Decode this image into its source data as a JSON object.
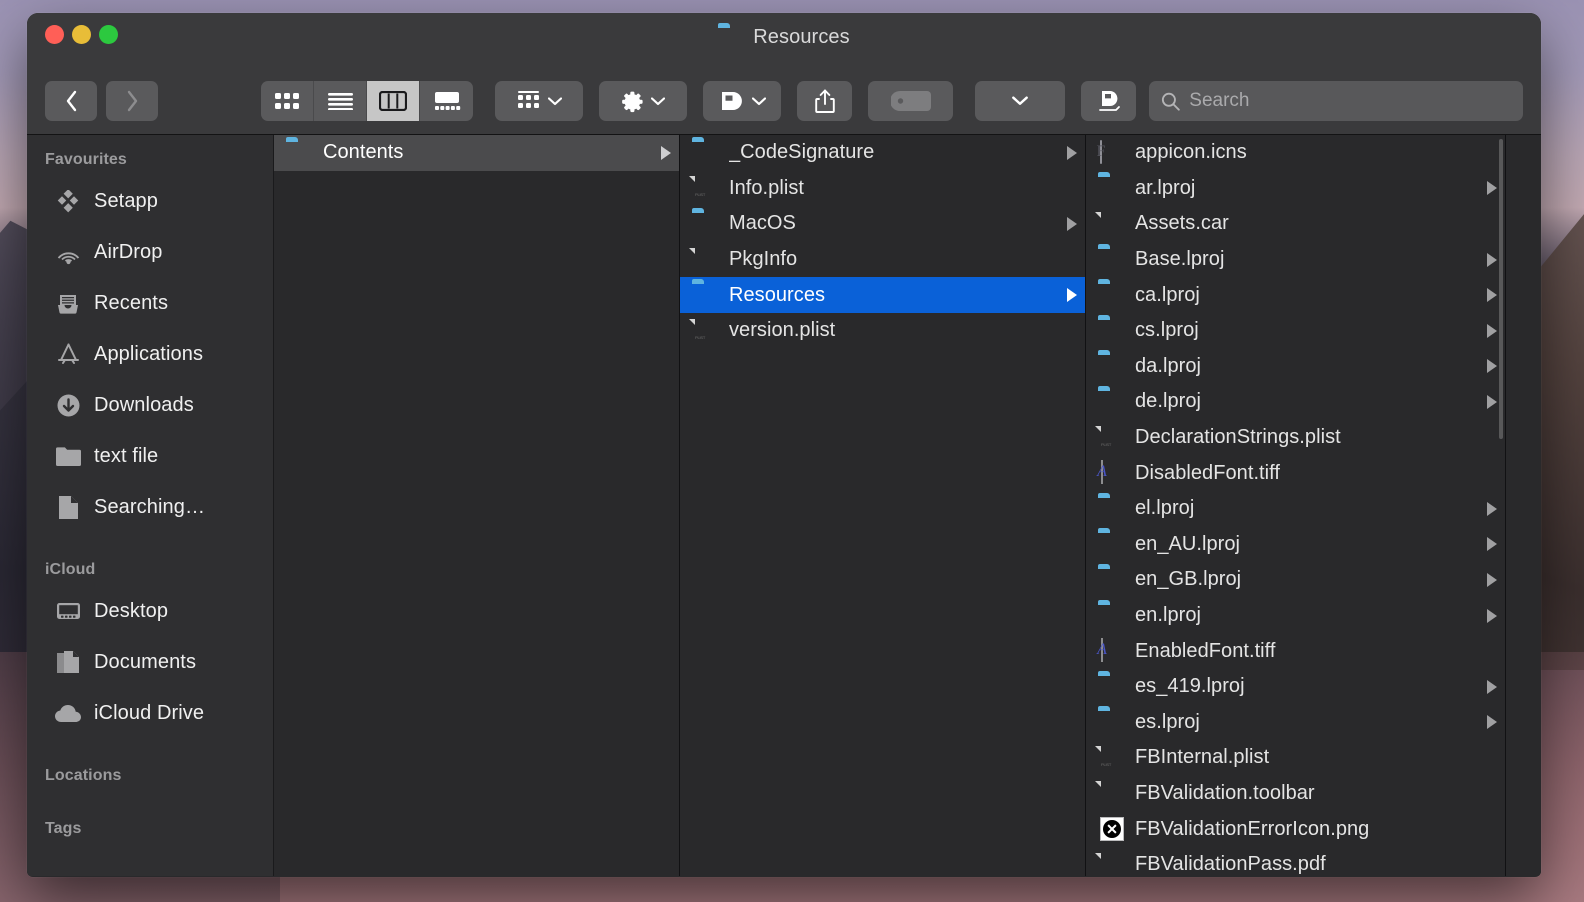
{
  "window": {
    "title": "Resources",
    "title_icon": "folder-icon",
    "traffic_lights": [
      "close",
      "minimize",
      "zoom"
    ]
  },
  "toolbar": {
    "back_label": "‹",
    "forward_label": "›",
    "view_modes": [
      {
        "name": "icon-view",
        "active": false
      },
      {
        "name": "list-view",
        "active": false
      },
      {
        "name": "column-view",
        "active": true
      },
      {
        "name": "gallery-view",
        "active": false
      }
    ],
    "group_button": "group-icon",
    "action_button": "gear-icon",
    "quicklook_button": "dropbox-icon",
    "share_button": "share-icon",
    "tag_button": "tag-icon",
    "extra_button": "chevron-down-icon",
    "dropbox_button": "dropbox-badge-icon",
    "search": {
      "placeholder": "Search",
      "value": "",
      "icon": "search-icon"
    }
  },
  "sidebar": {
    "sections": [
      {
        "header": "Favourites",
        "items": [
          {
            "label": "Setapp",
            "icon": "setapp-icon"
          },
          {
            "label": "AirDrop",
            "icon": "airdrop-icon"
          },
          {
            "label": "Recents",
            "icon": "recents-icon"
          },
          {
            "label": "Applications",
            "icon": "applications-icon"
          },
          {
            "label": "Downloads",
            "icon": "downloads-icon"
          },
          {
            "label": "text file",
            "icon": "folder-icon"
          },
          {
            "label": "Searching…",
            "icon": "document-icon"
          }
        ]
      },
      {
        "header": "iCloud",
        "items": [
          {
            "label": "Desktop",
            "icon": "desktop-icon"
          },
          {
            "label": "Documents",
            "icon": "documents-icon"
          },
          {
            "label": "iCloud Drive",
            "icon": "cloud-icon"
          }
        ]
      },
      {
        "header": "Locations",
        "items": []
      },
      {
        "header": "Tags",
        "items": []
      }
    ]
  },
  "columns": [
    {
      "name": "column-1",
      "items": [
        {
          "label": "Contents",
          "icon": "folder-icon",
          "kind": "folder",
          "has_arrow": true,
          "selected": "inactive"
        }
      ]
    },
    {
      "name": "column-2",
      "items": [
        {
          "label": "_CodeSignature",
          "icon": "folder-icon",
          "kind": "folder",
          "has_arrow": true,
          "selected": "none"
        },
        {
          "label": "Info.plist",
          "icon": "plist-icon",
          "kind": "plist",
          "has_arrow": false,
          "selected": "none"
        },
        {
          "label": "MacOS",
          "icon": "folder-icon",
          "kind": "folder",
          "has_arrow": true,
          "selected": "none"
        },
        {
          "label": "PkgInfo",
          "icon": "document-icon",
          "kind": "doc",
          "has_arrow": false,
          "selected": "none"
        },
        {
          "label": "Resources",
          "icon": "folder-icon",
          "kind": "folder",
          "has_arrow": true,
          "selected": "active"
        },
        {
          "label": "version.plist",
          "icon": "plist-icon",
          "kind": "plist",
          "has_arrow": false,
          "selected": "none"
        }
      ]
    },
    {
      "name": "column-3",
      "items": [
        {
          "label": "appicon.icns",
          "icon": "icns-icon",
          "kind": "icns",
          "has_arrow": false,
          "selected": "none"
        },
        {
          "label": "ar.lproj",
          "icon": "folder-icon",
          "kind": "folder",
          "has_arrow": true,
          "selected": "none"
        },
        {
          "label": "Assets.car",
          "icon": "document-icon",
          "kind": "doc",
          "has_arrow": false,
          "selected": "none"
        },
        {
          "label": "Base.lproj",
          "icon": "folder-icon",
          "kind": "folder",
          "has_arrow": true,
          "selected": "none"
        },
        {
          "label": "ca.lproj",
          "icon": "folder-icon",
          "kind": "folder",
          "has_arrow": true,
          "selected": "none"
        },
        {
          "label": "cs.lproj",
          "icon": "folder-icon",
          "kind": "folder",
          "has_arrow": true,
          "selected": "none"
        },
        {
          "label": "da.lproj",
          "icon": "folder-icon",
          "kind": "folder",
          "has_arrow": true,
          "selected": "none"
        },
        {
          "label": "de.lproj",
          "icon": "folder-icon",
          "kind": "folder",
          "has_arrow": true,
          "selected": "none"
        },
        {
          "label": "DeclarationStrings.plist",
          "icon": "plist-icon",
          "kind": "plist",
          "has_arrow": false,
          "selected": "none"
        },
        {
          "label": "DisabledFont.tiff",
          "icon": "font-icon",
          "kind": "font",
          "has_arrow": false,
          "selected": "none"
        },
        {
          "label": "el.lproj",
          "icon": "folder-icon",
          "kind": "folder",
          "has_arrow": true,
          "selected": "none"
        },
        {
          "label": "en_AU.lproj",
          "icon": "folder-icon",
          "kind": "folder",
          "has_arrow": true,
          "selected": "none"
        },
        {
          "label": "en_GB.lproj",
          "icon": "folder-icon",
          "kind": "folder",
          "has_arrow": true,
          "selected": "none"
        },
        {
          "label": "en.lproj",
          "icon": "folder-icon",
          "kind": "folder",
          "has_arrow": true,
          "selected": "none"
        },
        {
          "label": "EnabledFont.tiff",
          "icon": "font-icon",
          "kind": "font",
          "has_arrow": false,
          "selected": "none"
        },
        {
          "label": "es_419.lproj",
          "icon": "folder-icon",
          "kind": "folder",
          "has_arrow": true,
          "selected": "none"
        },
        {
          "label": "es.lproj",
          "icon": "folder-icon",
          "kind": "folder",
          "has_arrow": true,
          "selected": "none"
        },
        {
          "label": "FBInternal.plist",
          "icon": "plist-icon",
          "kind": "plist",
          "has_arrow": false,
          "selected": "none"
        },
        {
          "label": "FBValidation.toolbar",
          "icon": "document-icon",
          "kind": "doc",
          "has_arrow": false,
          "selected": "none"
        },
        {
          "label": "FBValidationErrorIcon.png",
          "icon": "error-icon",
          "kind": "error",
          "has_arrow": false,
          "selected": "none"
        },
        {
          "label": "FBValidationPass.pdf",
          "icon": "pdf-icon",
          "kind": "pdf",
          "has_arrow": false,
          "selected": "none"
        }
      ]
    }
  ],
  "colors": {
    "selection_blue": "#0a61d8",
    "selection_inactive": "#4b4b4d",
    "folder_blue": "#4fa8d8",
    "window_chrome": "#3a3a3c",
    "sidebar_bg": "#2f2f31",
    "column_bg": "#29292b"
  }
}
